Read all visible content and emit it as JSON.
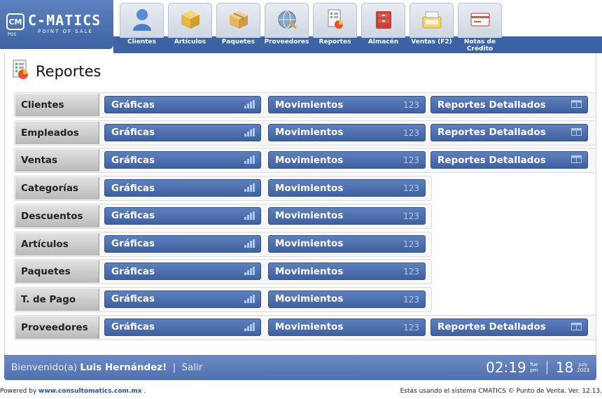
{
  "brand": {
    "name": "C-MATICS",
    "abbr": "CM",
    "tag": "POINT OF SALE",
    "pos_tag": "POS"
  },
  "nav": [
    {
      "label": "Clientes",
      "icon": "person-icon"
    },
    {
      "label": "Artículos",
      "icon": "box-icon"
    },
    {
      "label": "Paquetes",
      "icon": "package-icon"
    },
    {
      "label": "Proveedores",
      "icon": "globe-icon"
    },
    {
      "label": "Reportes",
      "icon": "report-icon"
    },
    {
      "label": "Almacén",
      "icon": "cabinet-icon"
    },
    {
      "label": "Ventas (F2)",
      "icon": "register-icon"
    },
    {
      "label": "Notas de Crédito",
      "icon": "credit-card-icon"
    }
  ],
  "page": {
    "title": "Reportes"
  },
  "buttons": {
    "graficas": "Gráficas",
    "movimientos": "Movimientos",
    "movimientos_suffix": "123",
    "detallados": "Reportes Detallados"
  },
  "rows": [
    {
      "label": "Clientes",
      "detailed": true
    },
    {
      "label": "Empleados",
      "detailed": true
    },
    {
      "label": "Ventas",
      "detailed": true
    },
    {
      "label": "Categorías",
      "detailed": false
    },
    {
      "label": "Descuentos",
      "detailed": false
    },
    {
      "label": "Artículos",
      "detailed": false
    },
    {
      "label": "Paquetes",
      "detailed": false
    },
    {
      "label": "T. de Pago",
      "detailed": false
    },
    {
      "label": "Proveedores",
      "detailed": true
    }
  ],
  "footer": {
    "welcome": "Bienvenido(a)",
    "user": "Luis Hernández!",
    "separator": "|",
    "logout": "Salir",
    "time": "02:19",
    "weekday": "Tue",
    "ampm": "pm",
    "day": "18",
    "month": "July",
    "year": "2023"
  },
  "bottom": {
    "powered": "Powered by",
    "site": "www.consultomatics.com.mx",
    "dot": ".",
    "version": "Estás usando el sistema CMATICS © Punto de Venta. Ver. 12.13."
  },
  "colors": {
    "accent": "#3e63a4",
    "button": "#4f71af",
    "row_label": "#c9c9c9"
  }
}
